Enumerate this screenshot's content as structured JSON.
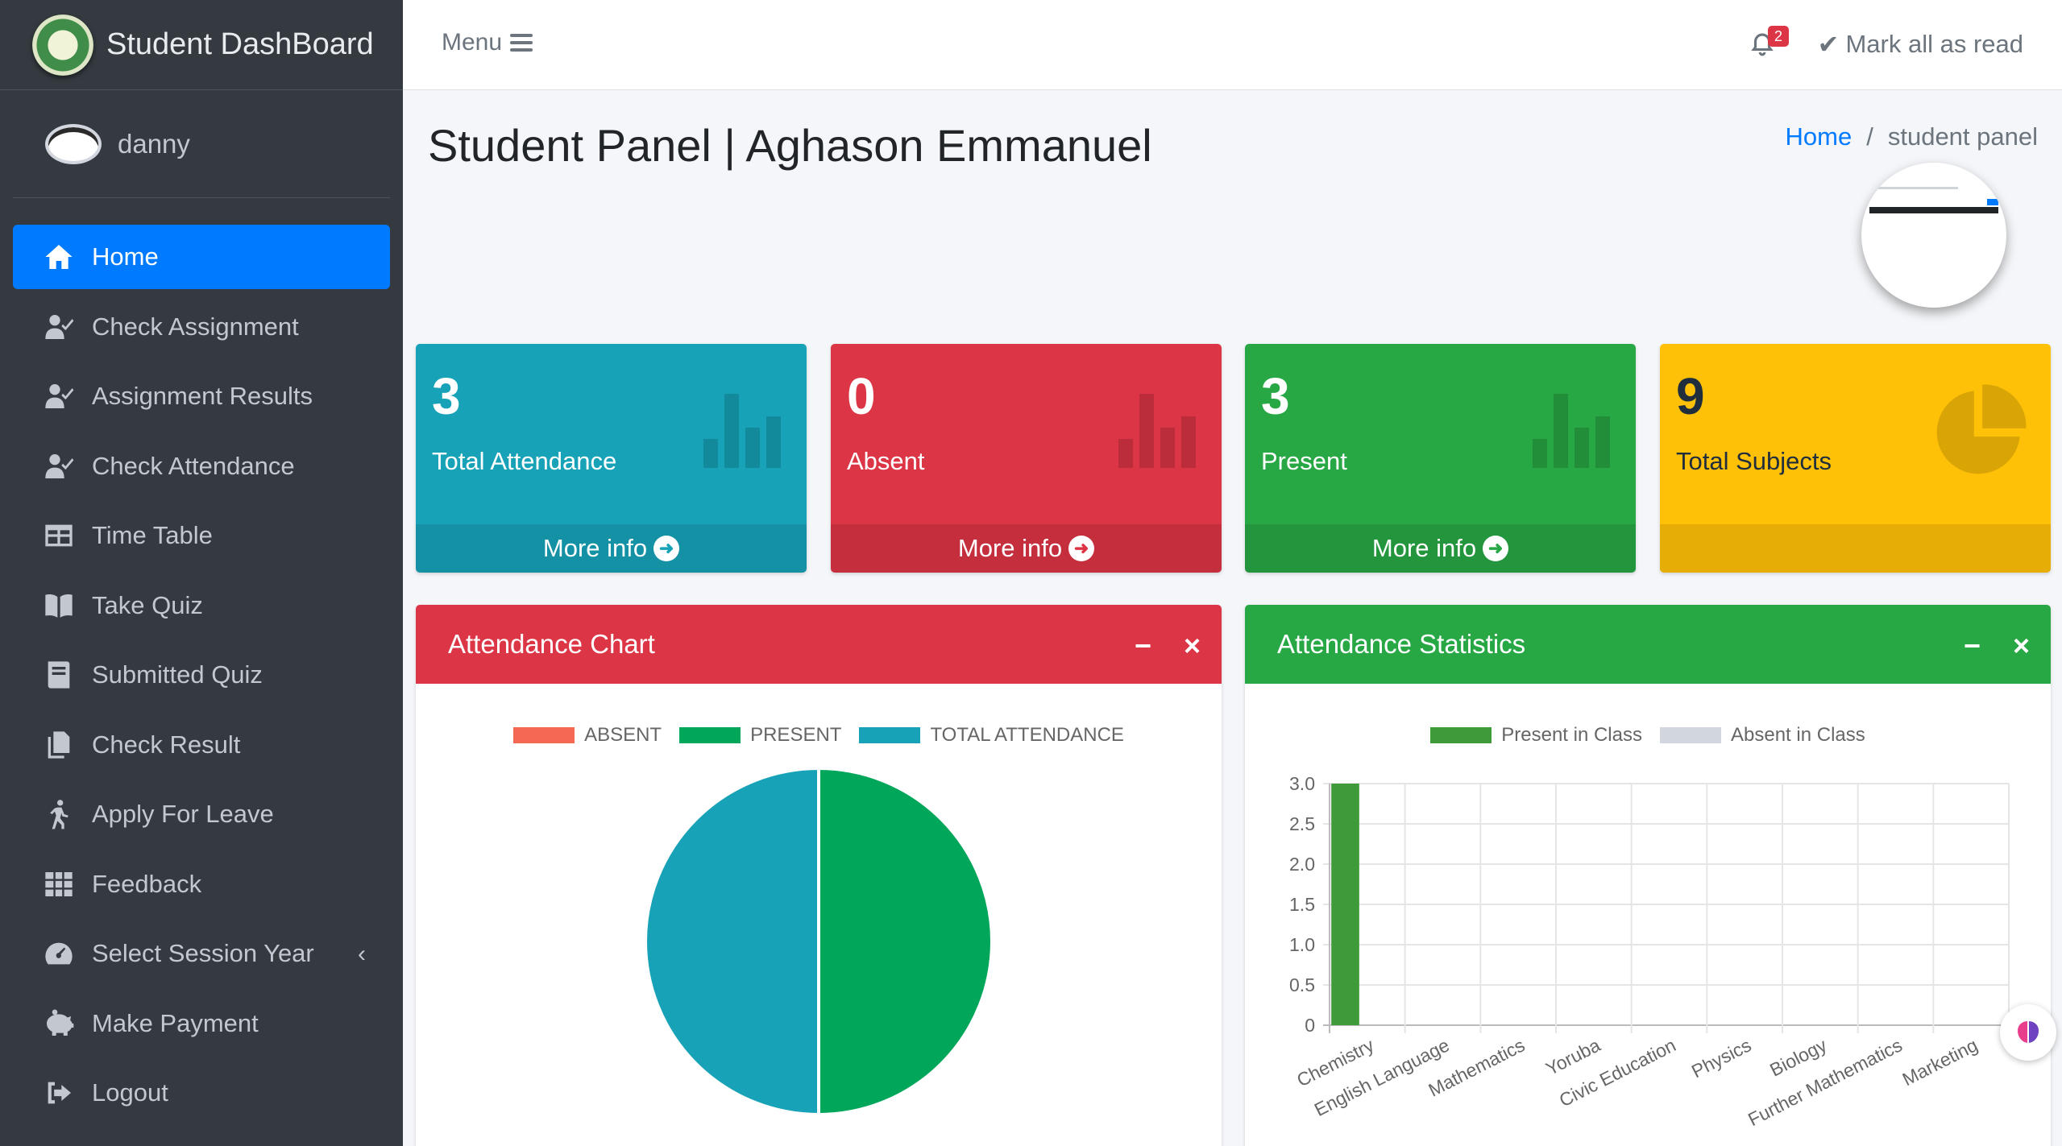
{
  "brand": {
    "title": "Student DashBoard"
  },
  "user": {
    "name": "danny"
  },
  "sidebar": {
    "items": [
      {
        "label": "Home",
        "icon": "home-icon",
        "active": true
      },
      {
        "label": "Check Assignment",
        "icon": "user-check-icon"
      },
      {
        "label": "Assignment Results",
        "icon": "user-check-icon"
      },
      {
        "label": "Check Attendance",
        "icon": "user-check-icon"
      },
      {
        "label": "Time Table",
        "icon": "table-icon"
      },
      {
        "label": "Take Quiz",
        "icon": "book-open-icon"
      },
      {
        "label": "Submitted Quiz",
        "icon": "book-icon"
      },
      {
        "label": "Check Result",
        "icon": "copy-icon"
      },
      {
        "label": "Apply For Leave",
        "icon": "walking-icon"
      },
      {
        "label": "Feedback",
        "icon": "grid-icon"
      },
      {
        "label": "Select Session Year",
        "icon": "tachometer-icon",
        "chevron": "‹"
      },
      {
        "label": "Make Payment",
        "icon": "piggy-bank-icon"
      },
      {
        "label": "Logout",
        "icon": "sign-out-icon"
      }
    ]
  },
  "topbar": {
    "menu_label": "Menu",
    "notification_count": "2",
    "mark_all_label": "Mark all as read",
    "check_glyph": "✔"
  },
  "header": {
    "title": "Student Panel | Aghason Emmanuel",
    "breadcrumb_home": "Home",
    "breadcrumb_sep": "/",
    "breadcrumb_current": "student panel"
  },
  "stats": [
    {
      "value": "3",
      "label": "Total Attendance",
      "footer": "More info",
      "color": "#17a2b8",
      "icon": "bar-chart-icon"
    },
    {
      "value": "0",
      "label": "Absent",
      "footer": "More info",
      "color": "#dc3545",
      "icon": "bar-chart-icon"
    },
    {
      "value": "3",
      "label": "Present",
      "footer": "More info",
      "color": "#28a745",
      "icon": "bar-chart-icon"
    },
    {
      "value": "9",
      "label": "Total Subjects",
      "footer": "",
      "color": "#ffc107",
      "icon": "pie-chart-icon"
    }
  ],
  "attendance_chart_card": {
    "title": "Attendance Chart",
    "header_color": "#dc3545",
    "minimize_glyph": "−",
    "close_glyph": "×"
  },
  "attendance_stats_card": {
    "title": "Attendance Statistics",
    "header_color": "#28a745",
    "minimize_glyph": "−",
    "close_glyph": "×"
  },
  "chart_data": [
    {
      "type": "pie",
      "categories": [
        "ABSENT",
        "PRESENT",
        "TOTAL ATTENDANCE"
      ],
      "values": [
        0,
        3,
        3
      ],
      "colors": [
        "#f56954",
        "#00a65a",
        "#17a2b8"
      ],
      "legend_position": "top"
    },
    {
      "type": "bar",
      "categories": [
        "Chemistry",
        "English Language",
        "Mathematics",
        "Yoruba",
        "Civic Education",
        "Physics",
        "Biology",
        "Further Mathematics",
        "Marketing"
      ],
      "series": [
        {
          "name": "Present in Class",
          "values": [
            3,
            0,
            0,
            0,
            0,
            0,
            0,
            0,
            0
          ],
          "color": "#3f9b3a"
        },
        {
          "name": "Absent in Class",
          "values": [
            0,
            0,
            0,
            0,
            0,
            0,
            0,
            0,
            0
          ],
          "color": "#d2d6de"
        }
      ],
      "y_ticks": [
        "0",
        "0.5",
        "1.0",
        "1.5",
        "2.0",
        "2.5",
        "3.0"
      ],
      "ylim": [
        0,
        3
      ],
      "grid": true,
      "legend_position": "top"
    }
  ]
}
